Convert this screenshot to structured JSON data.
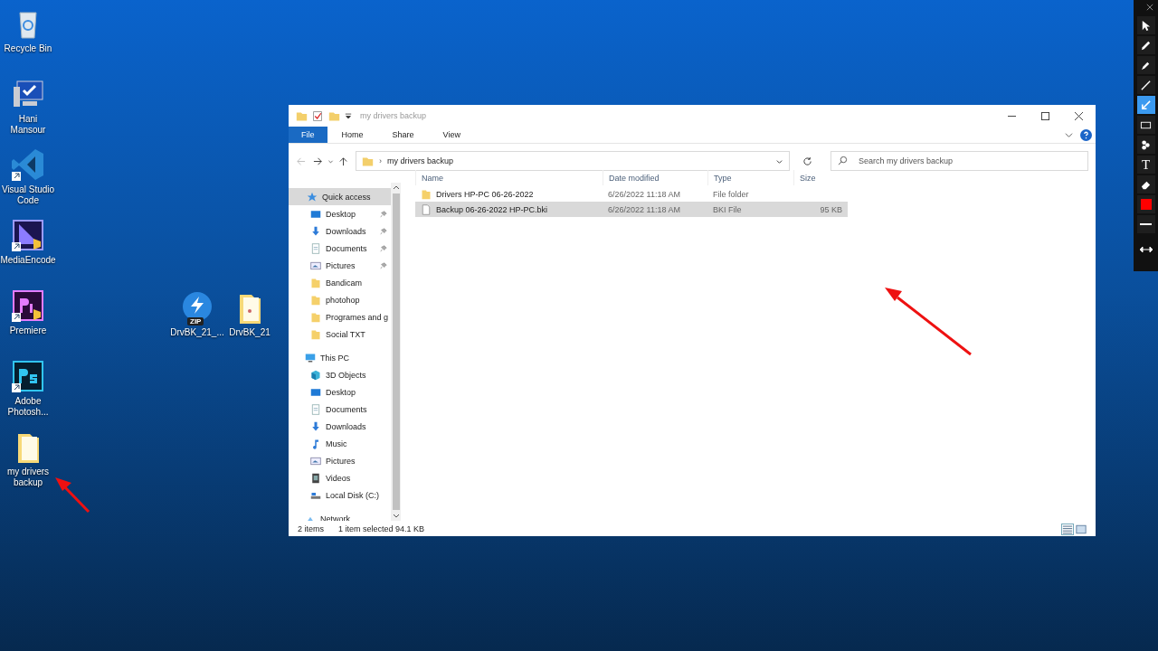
{
  "desktop": {
    "icons": [
      {
        "label": "Recycle Bin",
        "kind": "recycle",
        "shortcut": false
      },
      {
        "label": "Hani Mansour",
        "kind": "pc",
        "shortcut": false
      },
      {
        "label": "Visual Studio Code",
        "kind": "vscode",
        "shortcut": true
      },
      {
        "label": "MediaEncode",
        "kind": "encoder",
        "shortcut": true
      },
      {
        "label": "Premiere",
        "kind": "premiere",
        "shortcut": true
      },
      {
        "label": "Adobe Photosh...",
        "kind": "photoshop",
        "shortcut": true
      },
      {
        "label": "my drivers backup",
        "kind": "folder",
        "shortcut": false
      }
    ],
    "loose_icons": [
      {
        "label": "DrvBK_21_...",
        "kind": "zip",
        "badge": "ZIP"
      },
      {
        "label": "DrvBK_21",
        "kind": "folder"
      }
    ]
  },
  "window": {
    "title": "my drivers backup",
    "ribbon_tabs": [
      {
        "label": "File",
        "kind": "file"
      },
      {
        "label": "Home",
        "kind": "tab"
      },
      {
        "label": "Share",
        "kind": "tab"
      },
      {
        "label": "View",
        "kind": "tab"
      }
    ],
    "address_separator": "›",
    "address": "my drivers backup",
    "search": {
      "placeholder": "Search my drivers backup"
    },
    "nav": [
      {
        "label": "Quick access",
        "kind": "star",
        "selected": true,
        "children": [
          {
            "label": "Desktop",
            "kind": "desktop",
            "pinned": true
          },
          {
            "label": "Downloads",
            "kind": "download",
            "pinned": true
          },
          {
            "label": "Documents",
            "kind": "document",
            "pinned": true
          },
          {
            "label": "Pictures",
            "kind": "pictures",
            "pinned": true
          },
          {
            "label": "Bandicam",
            "kind": "folder",
            "pinned": false
          },
          {
            "label": "photohop",
            "kind": "folder",
            "pinned": false
          },
          {
            "label": "Programes and g",
            "kind": "folder",
            "pinned": false
          },
          {
            "label": "Social TXT",
            "kind": "folder",
            "pinned": false
          }
        ]
      },
      {
        "label": "This PC",
        "kind": "pc",
        "selected": false,
        "children": [
          {
            "label": "3D Objects",
            "kind": "cube",
            "pinned": false
          },
          {
            "label": "Desktop",
            "kind": "desktop",
            "pinned": false
          },
          {
            "label": "Documents",
            "kind": "document",
            "pinned": false
          },
          {
            "label": "Downloads",
            "kind": "download",
            "pinned": false
          },
          {
            "label": "Music",
            "kind": "music",
            "pinned": false
          },
          {
            "label": "Pictures",
            "kind": "pictures",
            "pinned": false
          },
          {
            "label": "Videos",
            "kind": "videos",
            "pinned": false
          },
          {
            "label": "Local Disk (C:)",
            "kind": "disk",
            "pinned": false
          }
        ]
      },
      {
        "label": "Network",
        "kind": "network",
        "selected": false
      }
    ],
    "columns": [
      "Name",
      "Date modified",
      "Type",
      "Size"
    ],
    "rows": [
      {
        "kind": "folder",
        "name": "Drivers HP-PC 06-26-2022",
        "date": "6/26/2022 11:18 AM",
        "type": "File folder",
        "selected": false
      },
      {
        "kind": "file",
        "name": "Backup 06-26-2022  HP-PC.bki",
        "date": "6/26/2022 11:18 AM",
        "type": "BKI File",
        "size": "95 KB",
        "selected": true
      }
    ],
    "status": {
      "count": "2 items",
      "selection": "1 item selected  94.1 KB"
    }
  },
  "annotation_toolbar": {
    "tools": [
      {
        "kind": "pointer",
        "selected": false
      },
      {
        "kind": "pencil",
        "selected": false
      },
      {
        "kind": "marker",
        "selected": false
      },
      {
        "kind": "line",
        "selected": false
      },
      {
        "kind": "arrow",
        "selected": true
      },
      {
        "kind": "rectangle",
        "selected": false
      },
      {
        "kind": "stamp",
        "selected": false
      },
      {
        "kind": "text",
        "label": "T",
        "selected": false
      },
      {
        "kind": "eraser",
        "selected": false
      }
    ],
    "color": "#ff0000"
  }
}
